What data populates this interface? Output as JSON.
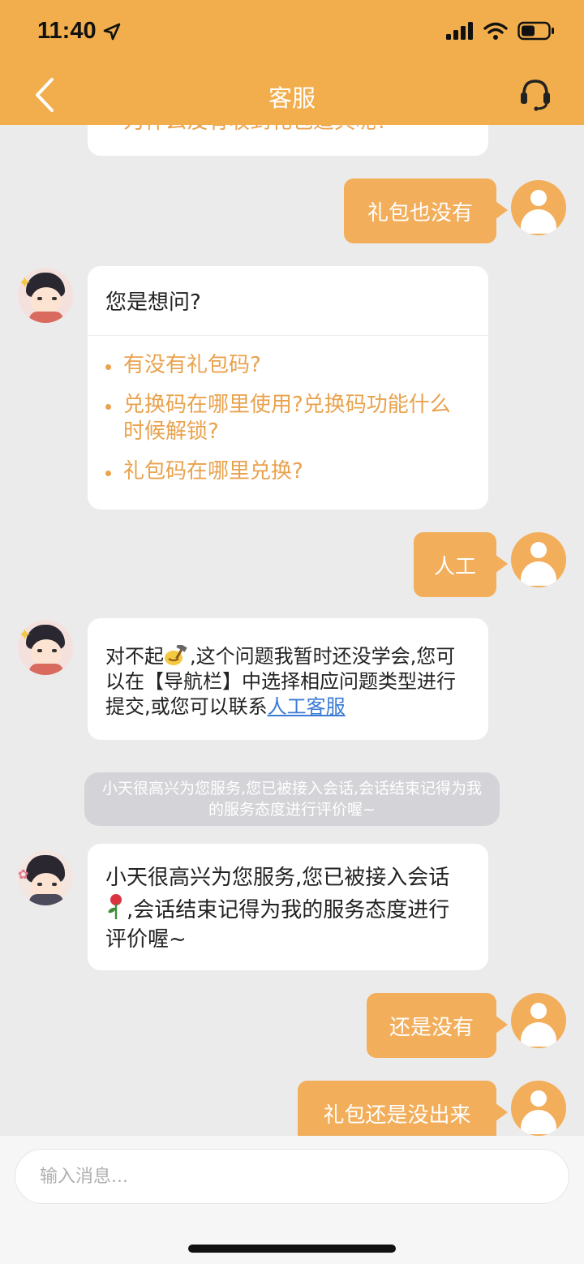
{
  "status_bar": {
    "time": "11:40"
  },
  "header": {
    "title": "客服"
  },
  "messages": {
    "top_cut_text": "为什么没有收到礼包道具呢?",
    "out1": "礼包也没有",
    "question_card": {
      "heading": "您是想问?",
      "items": [
        "有没有礼包码?",
        "兑换码在哪里使用?兑换码功能什么时候解锁?",
        "礼包码在哪里兑换?"
      ]
    },
    "out2": "人工",
    "bot_reply": {
      "part1": "对不起",
      "part2": ",这个问题我暂时还没学会,您可以在【导航栏】中选择相应问题类型进行提交,或您可以联系",
      "link": "人工客服"
    },
    "system_notice": "小天很高兴为您服务,您已被接入会话,会话结束记得为我的服务态度进行评价喔~",
    "agent_greeting": {
      "part1": "小天很高兴为您服务,您已被接入会话",
      "part2": ",会话结束记得为我的服务态度进行评价喔~"
    },
    "out3": "还是没有",
    "out4": "礼包还是没出来"
  },
  "input": {
    "placeholder": "输入消息..."
  },
  "colors": {
    "header": "#f2ae4c",
    "bubble_out": "#f2ae5a",
    "link": "#3a7bd5",
    "question": "#e9a24d"
  },
  "icons": [
    "back-arrow-icon",
    "headset-icon",
    "location-arrow-icon",
    "signal-icon",
    "wifi-icon",
    "battery-icon",
    "user-avatar-icon",
    "bot-avatar-icon",
    "rose-emoji-icon",
    "hammer-emoji-icon"
  ]
}
